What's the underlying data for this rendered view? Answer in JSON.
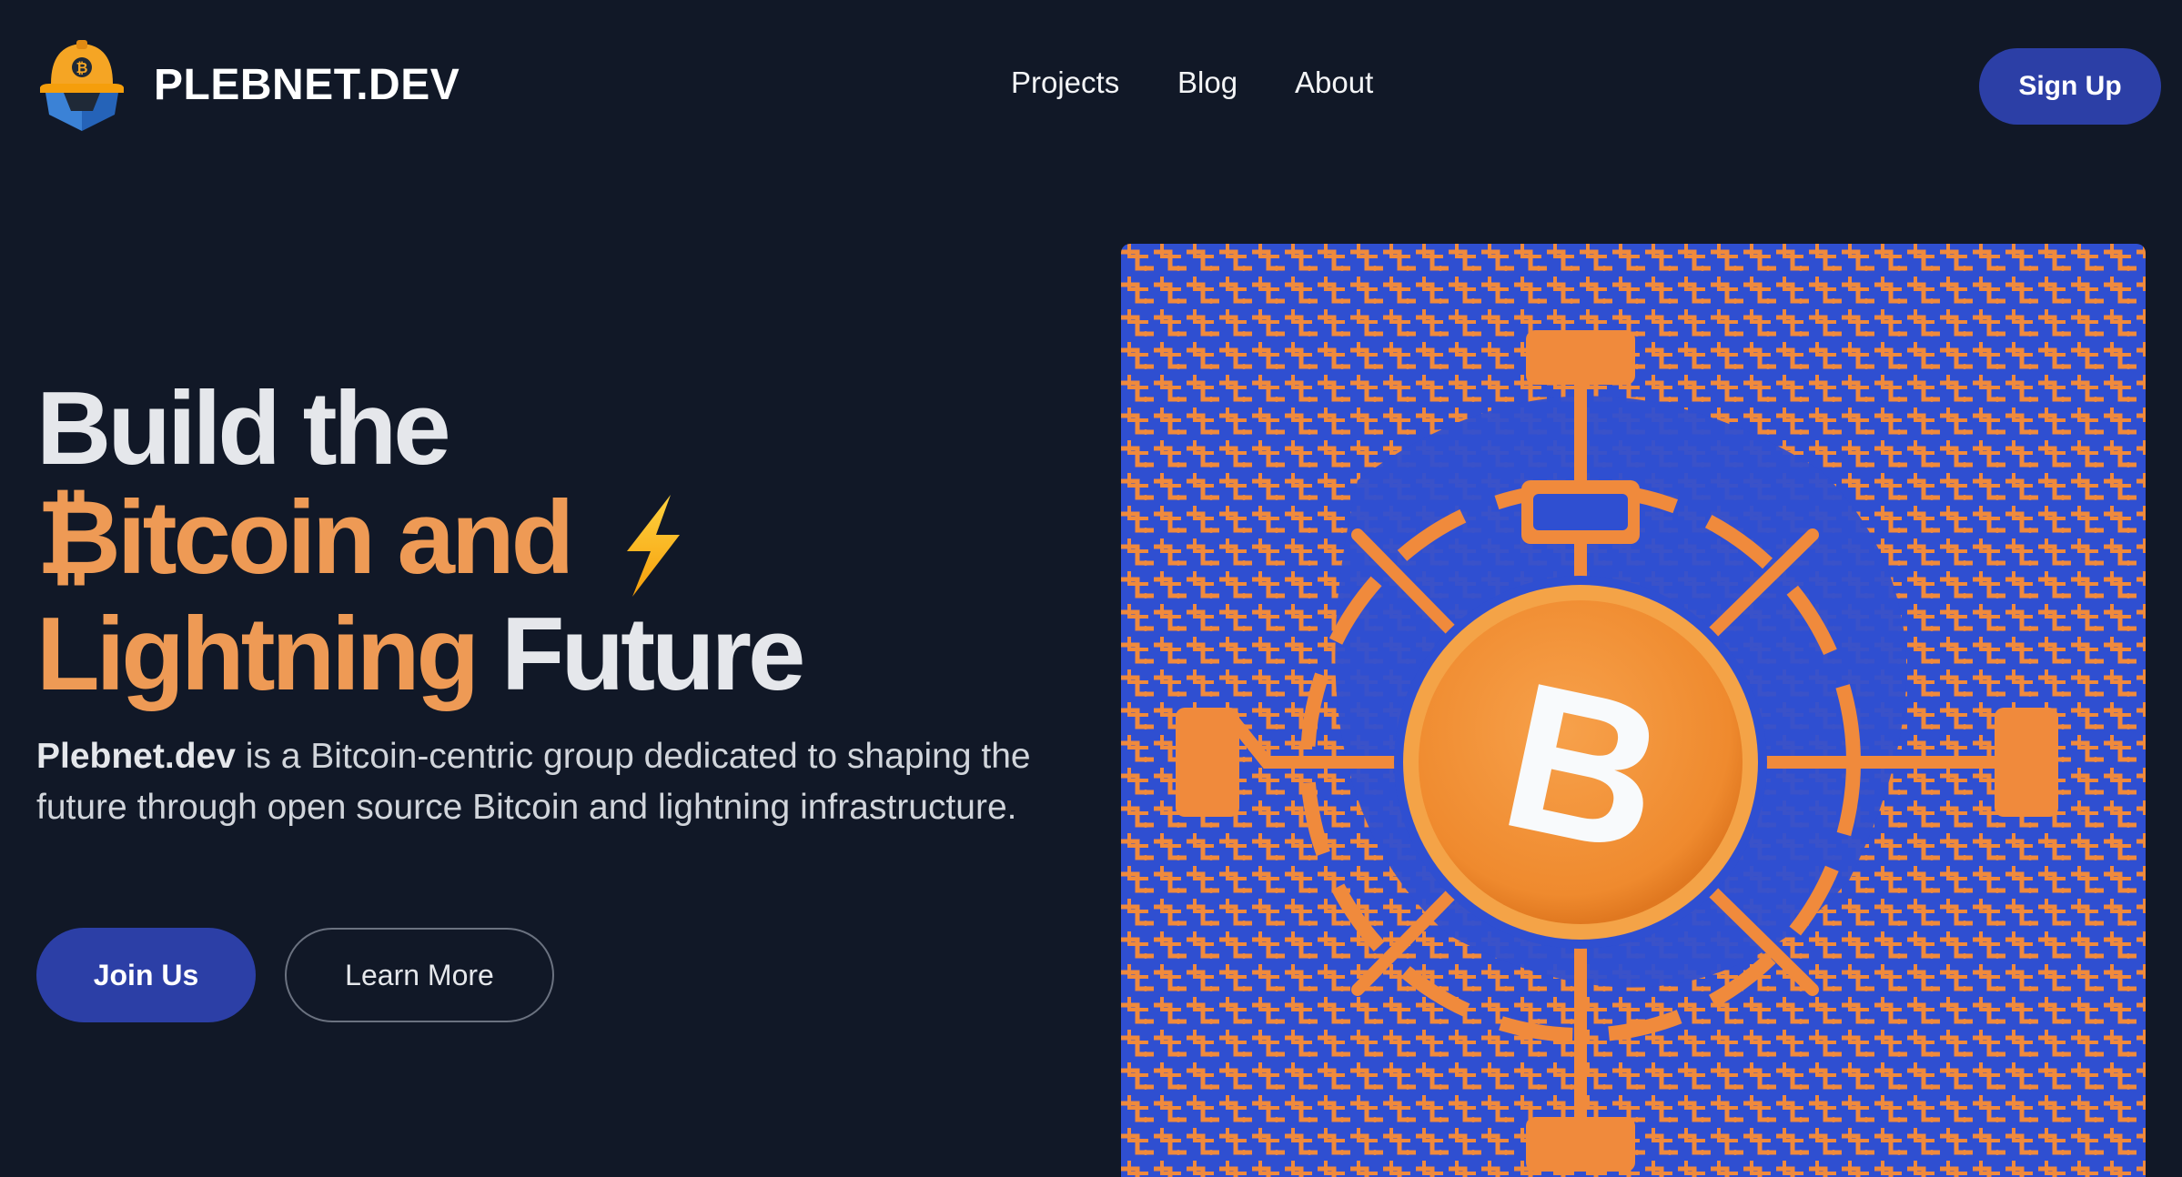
{
  "header": {
    "brand": "PLEBNET.DEV",
    "nav": [
      "Projects",
      "Blog",
      "About"
    ],
    "signup_label": "Sign Up"
  },
  "hero": {
    "headline_line1": "Build the",
    "headline_line2": "₿itcoin and",
    "headline_line3_orange": "Lightning",
    "headline_line3_white": "Future",
    "description_strong": "Plebnet.dev",
    "description_rest": " is a Bitcoin-centric group dedicated to shaping the future through open source Bitcoin and lightning infrastructure.",
    "join_label": "Join Us",
    "learn_label": "Learn More",
    "coin_symbol": "B"
  },
  "colors": {
    "background": "#111827",
    "accent_orange": "#ee9a55",
    "primary_blue": "#2c3fa6",
    "circuit_blue": "#2f4fd1",
    "circuit_orange": "#f08a3c"
  },
  "icons": [
    "hardhat-bitcoin-logo-icon",
    "lightning-bolt-icon",
    "bitcoin-coin-icon"
  ]
}
